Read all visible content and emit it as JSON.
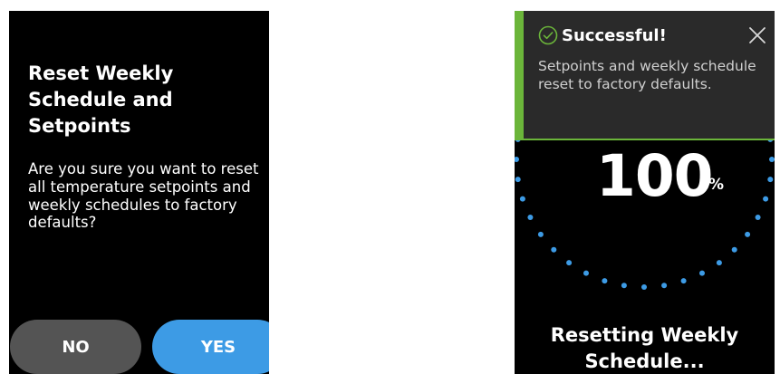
{
  "confirm_dialog": {
    "title": "Reset Weekly Schedule and Setpoints",
    "body": "Are you sure you want to reset all temperature setpoints and weekly schedules to factory defaults?",
    "no_label": "NO",
    "yes_label": "YES"
  },
  "progress_screen": {
    "toast": {
      "title": "Successful!",
      "message": "Setpoints and weekly schedule reset to factory defaults.",
      "icon": "check-circle-icon",
      "close_icon": "close-icon"
    },
    "progress_value": "100",
    "progress_unit": "%",
    "progress_fraction": 1.0,
    "status_label": "Resetting Weekly Schedule..."
  },
  "colors": {
    "screen_bg": "#000000",
    "yes_button": "#3d9be5",
    "no_button": "#545454",
    "success_accent": "#6bb53a",
    "toast_bg": "#2a2a2a",
    "progress_dot": "#3d9be5"
  }
}
